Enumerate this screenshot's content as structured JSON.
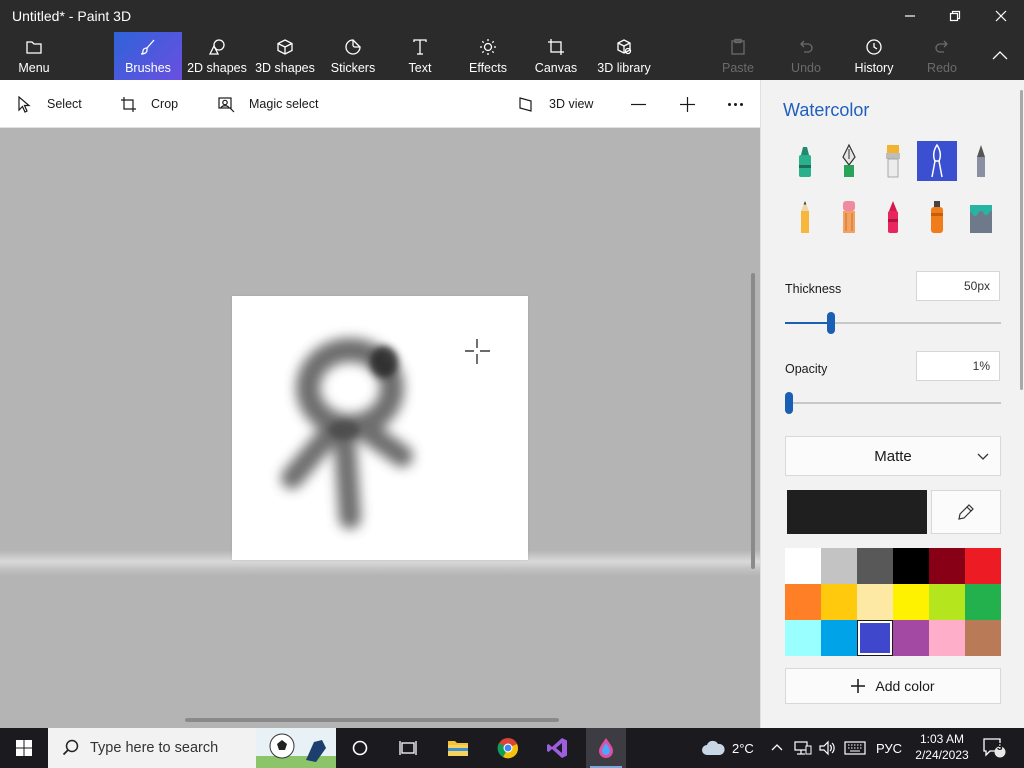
{
  "window": {
    "title": "Untitled* - Paint 3D"
  },
  "ribbon": {
    "tabs": [
      {
        "label": "Menu",
        "icon": "folder-icon",
        "active": false,
        "enabled": true
      },
      {
        "label": "Brushes",
        "icon": "brush-icon",
        "active": true,
        "enabled": true
      },
      {
        "label": "2D shapes",
        "icon": "shapes-2d-icon",
        "active": false,
        "enabled": true
      },
      {
        "label": "3D shapes",
        "icon": "cube-icon",
        "active": false,
        "enabled": true
      },
      {
        "label": "Stickers",
        "icon": "sticker-icon",
        "active": false,
        "enabled": true
      },
      {
        "label": "Text",
        "icon": "text-icon",
        "active": false,
        "enabled": true
      },
      {
        "label": "Effects",
        "icon": "sun-icon",
        "active": false,
        "enabled": true
      },
      {
        "label": "Canvas",
        "icon": "canvas-crop-icon",
        "active": false,
        "enabled": true
      },
      {
        "label": "3D library",
        "icon": "library-icon",
        "active": false,
        "enabled": true
      },
      {
        "label": "Paste",
        "icon": "paste-icon",
        "active": false,
        "enabled": false
      },
      {
        "label": "Undo",
        "icon": "undo-icon",
        "active": false,
        "enabled": false
      },
      {
        "label": "History",
        "icon": "history-icon",
        "active": false,
        "enabled": true
      },
      {
        "label": "Redo",
        "icon": "redo-icon",
        "active": false,
        "enabled": false
      }
    ],
    "accent": "#2f63d8"
  },
  "toolbar": {
    "select_label": "Select",
    "crop_label": "Crop",
    "magic_select_label": "Magic select",
    "view3d_label": "3D view"
  },
  "panel": {
    "title": "Watercolor",
    "brushes": [
      "marker-icon",
      "calligraphy-pen-icon",
      "oil-brush-icon",
      "watercolor-icon",
      "pixel-pen-icon",
      "pencil-icon",
      "eraser-icon",
      "crayon-icon",
      "spray-can-icon",
      "fill-bucket-icon"
    ],
    "selected_brush": "watercolor-icon",
    "thickness": {
      "label": "Thickness",
      "value": "50px",
      "fraction": 0.2
    },
    "opacity": {
      "label": "Opacity",
      "value": "1%",
      "fraction": 0.0
    },
    "finish": {
      "value": "Matte"
    },
    "current_color": "#1f1f1f",
    "swatches": [
      "#ffffff",
      "#c3c3c3",
      "#585858",
      "#000000",
      "#880015",
      "#ed1c24",
      "#ff7f27",
      "#ffc90e",
      "#fde8a4",
      "#fff200",
      "#b5e61d",
      "#22b14c",
      "#99ffff",
      "#00a2e8",
      "#3f48cc",
      "#a349a4",
      "#ffaec9",
      "#b97a57"
    ],
    "selected_swatch": "#3f48cc",
    "add_color_label": "Add color"
  },
  "taskbar": {
    "search_placeholder": "Type here to search",
    "weather": "2°C",
    "language": "РУС",
    "time": "1:03 AM",
    "date": "2/24/2023",
    "notification_count": "3"
  }
}
